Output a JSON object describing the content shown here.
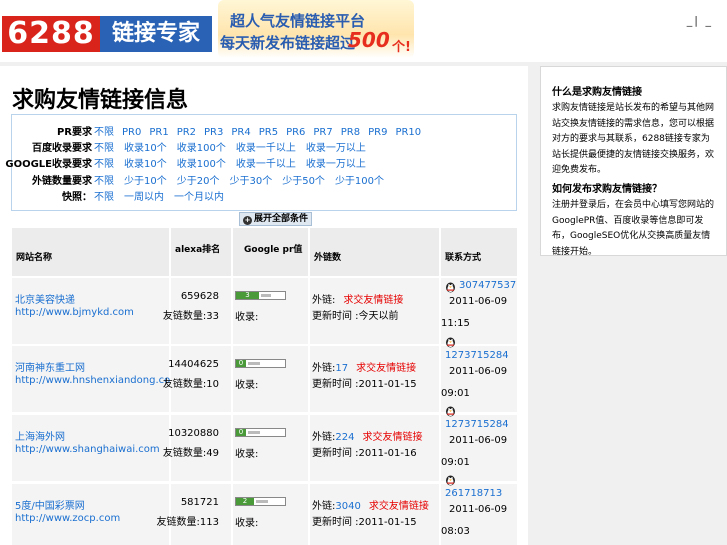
{
  "header": {
    "logo_number": "6288",
    "logo_text": "链接专家",
    "slogan_line1": "超人气友情链接平台",
    "slogan_line2": "每天新发布链接超过",
    "slogan_number": "500",
    "slogan_unit": "个!",
    "top_links": "_| _"
  },
  "page_title": "求购友情链接信息",
  "filters": [
    {
      "label": "PR要求",
      "options": [
        "不限",
        "PR0",
        "PR1",
        "PR2",
        "PR3",
        "PR4",
        "PR5",
        "PR6",
        "PR7",
        "PR8",
        "PR9",
        "PR10"
      ]
    },
    {
      "label": "百度收录要求",
      "options": [
        "不限",
        "收录10个",
        "收录100个",
        "收录一千以上",
        "收录一万以上"
      ]
    },
    {
      "label": "GOOGLE收录要求",
      "options": [
        "不限",
        "收录10个",
        "收录100个",
        "收录一千以上",
        "收录一万以上"
      ]
    },
    {
      "label": "外链数量要求",
      "options": [
        "不限",
        "少于10个",
        "少于20个",
        "少于30个",
        "少于50个",
        "少于100个"
      ]
    },
    {
      "label": "快照：",
      "options": [
        "不限",
        "一周以内",
        "一个月以内"
      ]
    }
  ],
  "expand_label": "展开全部条件",
  "table": {
    "headers": [
      "网站名称",
      "alexa排名",
      "Google pr值",
      "外链数",
      "联系方式"
    ],
    "rows": [
      {
        "name": "北京美容快递",
        "url": "http://www.bjmykd.com",
        "alexa": "659628",
        "friends": "友链数量:33",
        "pr": 3,
        "pr_text": "3",
        "rec": "收录:",
        "links": "外链:",
        "links_link": "",
        "links_note": "求交友情链接",
        "update": "更新时间 :今天以前",
        "qq": "307477537",
        "date": "2011-06-09",
        "time": "11:15"
      },
      {
        "name": "河南神东重工网",
        "url": "http://www.hnshenxiandong.com",
        "alexa": "14404625",
        "friends": "友链数量:10",
        "pr": 0,
        "pr_text": "0",
        "rec": "收录:",
        "links": "外链:",
        "links_link": "17",
        "links_note": "求交友情链接",
        "update": "更新时间 :2011-01-15",
        "qq": "1273715284",
        "date": "2011-06-09",
        "time": "09:01"
      },
      {
        "name": "上海海外网",
        "url": "http://www.shanghaiwai.com",
        "alexa": "10320880",
        "friends": "友链数量:49",
        "pr": 0,
        "pr_text": "0",
        "rec": "收录:",
        "links": "外链:",
        "links_link": "224",
        "links_note": "求交友情链接",
        "update": "更新时间 :2011-01-16",
        "qq": "1273715284",
        "date": "2011-06-09",
        "time": "09:01"
      },
      {
        "name": "5度/中国彩票网",
        "url": "http://www.zocp.com",
        "alexa": "581721",
        "friends": "友链数量:113",
        "pr": 2,
        "pr_text": "2",
        "rec": "收录:",
        "links": "外链:",
        "links_link": "3040",
        "links_note": "求交友情链接",
        "update": "更新时间 :2011-01-15",
        "qq": "261718713",
        "date": "2011-06-09",
        "time": "08:03"
      }
    ]
  },
  "sidebar": {
    "title1": "什么是求购友情链接",
    "para1": "求购友情链接是站长发布的希望与其他网站交换友情链接的需求信息，您可以根据对方的要求与其联系，6288链接专家为站长提供最便捷的友情链接交换服务，欢迎免费发布。",
    "title2": "如何发布求购友情链接？",
    "para2": "注册并登录后，在会员中心填写您网站的GooglePR值、百度收录等信息即可发布，GoogleSEO优化从交换高质量友情链接开始。"
  }
}
